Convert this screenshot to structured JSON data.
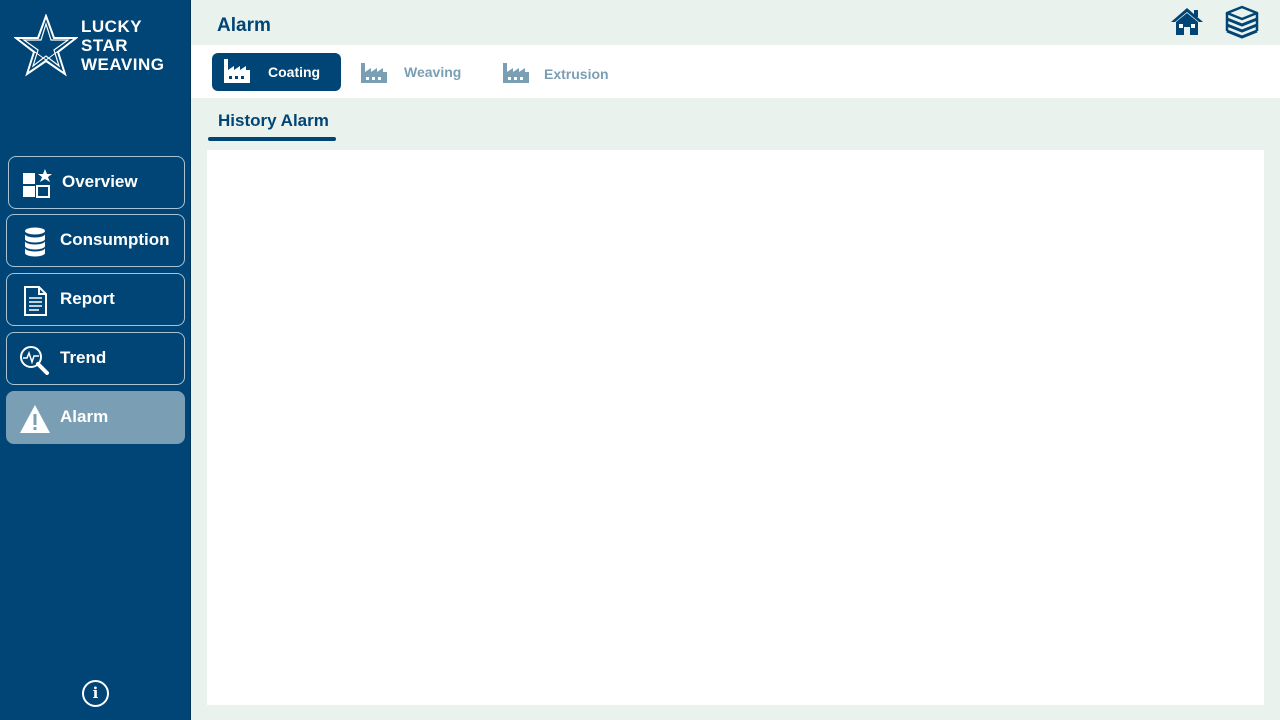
{
  "brand": {
    "line1": "LUCKY",
    "line2": "STAR",
    "line3": "WEAVING"
  },
  "header": {
    "title": "Alarm"
  },
  "sidebar": {
    "items": [
      {
        "label": "Overview",
        "icon": "overview-icon"
      },
      {
        "label": "Consumption",
        "icon": "database-icon"
      },
      {
        "label": "Report",
        "icon": "document-icon"
      },
      {
        "label": "Trend",
        "icon": "trend-search-icon"
      },
      {
        "label": "Alarm",
        "icon": "warning-icon",
        "active": true
      }
    ],
    "info_label": "i"
  },
  "tabs": [
    {
      "label": "Coating",
      "icon": "factory-icon",
      "active": true
    },
    {
      "label": "Weaving",
      "icon": "factory-icon"
    },
    {
      "label": "Extrusion",
      "icon": "factory-icon"
    }
  ],
  "subtab": {
    "label": "History Alarm"
  },
  "colors": {
    "primary": "#004575",
    "inactive": "#7a9fb4",
    "background": "#e9f2ec"
  }
}
